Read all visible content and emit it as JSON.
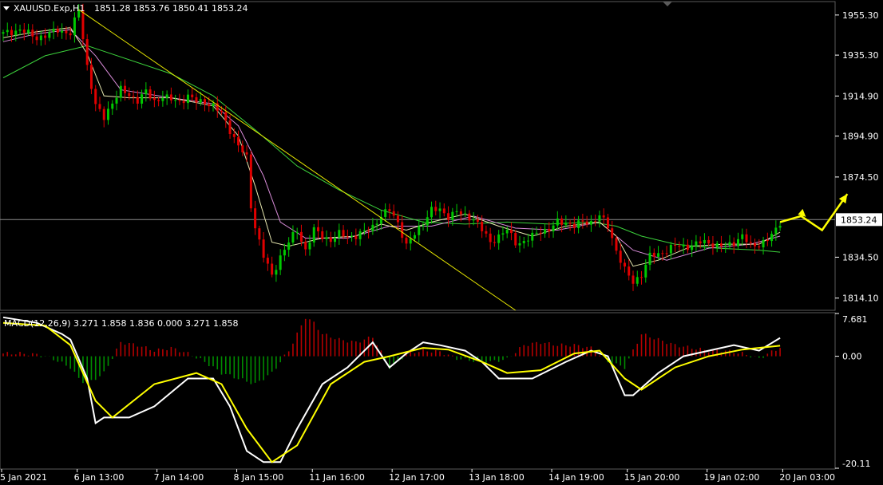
{
  "chart_data": [
    {
      "type": "candlestick",
      "title": "XAUUSD.Exp,H1",
      "ohlc_label": "1851.28 1853.76 1850.41 1853.24",
      "y_ticks": [
        "1955.30",
        "1935.30",
        "1914.90",
        "1894.90",
        "1874.50",
        "1834.50",
        "1814.10"
      ],
      "ylim": [
        1808,
        1962
      ],
      "current_price": 1853.24,
      "current_price_label": "1853.24",
      "x_labels": [
        "5 Jan 2021",
        "6 Jan 13:00",
        "7 Jan 14:00",
        "8 Jan 15:00",
        "11 Jan 16:00",
        "12 Jan 17:00",
        "13 Jan 18:00",
        "14 Jan 19:00",
        "15 Jan 20:00",
        "19 Jan 02:00",
        "20 Jan 03:00"
      ],
      "close_path": [
        [
          0,
          1946
        ],
        [
          4,
          1948
        ],
        [
          8,
          1944
        ],
        [
          10,
          1945
        ],
        [
          13,
          1948
        ],
        [
          16,
          1946
        ],
        [
          18,
          1958
        ],
        [
          20,
          1930
        ],
        [
          22,
          1910
        ],
        [
          24,
          1904
        ],
        [
          26,
          1912
        ],
        [
          28,
          1918
        ],
        [
          30,
          1915
        ],
        [
          32,
          1913
        ],
        [
          34,
          1917
        ],
        [
          36,
          1912
        ],
        [
          38,
          1915
        ],
        [
          40,
          1913
        ],
        [
          42,
          1912
        ],
        [
          44,
          1915
        ],
        [
          46,
          1912
        ],
        [
          48,
          1912
        ],
        [
          50,
          1910
        ],
        [
          52,
          1906
        ],
        [
          54,
          1898
        ],
        [
          56,
          1890
        ],
        [
          58,
          1884
        ],
        [
          59,
          1860
        ],
        [
          60,
          1850
        ],
        [
          62,
          1835
        ],
        [
          64,
          1825
        ],
        [
          66,
          1835
        ],
        [
          68,
          1842
        ],
        [
          70,
          1848
        ],
        [
          72,
          1838
        ],
        [
          74,
          1848
        ],
        [
          76,
          1845
        ],
        [
          78,
          1843
        ],
        [
          80,
          1846
        ],
        [
          82,
          1845
        ],
        [
          84,
          1845
        ],
        [
          86,
          1847
        ],
        [
          88,
          1850
        ],
        [
          90,
          1855
        ],
        [
          92,
          1858
        ],
        [
          94,
          1852
        ],
        [
          96,
          1840
        ],
        [
          98,
          1846
        ],
        [
          100,
          1852
        ],
        [
          102,
          1858
        ],
        [
          104,
          1858
        ],
        [
          106,
          1855
        ],
        [
          108,
          1857
        ],
        [
          110,
          1855
        ],
        [
          112,
          1854
        ],
        [
          114,
          1848
        ],
        [
          116,
          1842
        ],
        [
          118,
          1845
        ],
        [
          120,
          1848
        ],
        [
          122,
          1842
        ],
        [
          124,
          1842
        ],
        [
          126,
          1845
        ],
        [
          128,
          1848
        ],
        [
          130,
          1848
        ],
        [
          132,
          1852
        ],
        [
          134,
          1852
        ],
        [
          136,
          1850
        ],
        [
          138,
          1852
        ],
        [
          140,
          1852
        ],
        [
          142,
          1855
        ],
        [
          144,
          1850
        ],
        [
          146,
          1838
        ],
        [
          148,
          1828
        ],
        [
          150,
          1822
        ],
        [
          152,
          1826
        ],
        [
          154,
          1835
        ],
        [
          156,
          1836
        ],
        [
          158,
          1838
        ],
        [
          160,
          1840
        ],
        [
          162,
          1840
        ],
        [
          164,
          1840
        ],
        [
          166,
          1842
        ],
        [
          168,
          1842
        ],
        [
          170,
          1840
        ],
        [
          172,
          1840
        ],
        [
          174,
          1842
        ],
        [
          176,
          1845
        ],
        [
          178,
          1840
        ],
        [
          180,
          1841
        ],
        [
          182,
          1843
        ],
        [
          184,
          1848
        ],
        [
          185,
          1852
        ]
      ],
      "ma_fast": [
        [
          0,
          1944
        ],
        [
          8,
          1947
        ],
        [
          16,
          1949
        ],
        [
          20,
          1936
        ],
        [
          24,
          1915
        ],
        [
          30,
          1914
        ],
        [
          40,
          1914
        ],
        [
          50,
          1910
        ],
        [
          56,
          1895
        ],
        [
          60,
          1870
        ],
        [
          64,
          1842
        ],
        [
          68,
          1840
        ],
        [
          76,
          1844
        ],
        [
          84,
          1845
        ],
        [
          90,
          1851
        ],
        [
          96,
          1848
        ],
        [
          102,
          1852
        ],
        [
          110,
          1856
        ],
        [
          118,
          1850
        ],
        [
          126,
          1845
        ],
        [
          134,
          1850
        ],
        [
          142,
          1852
        ],
        [
          146,
          1845
        ],
        [
          150,
          1830
        ],
        [
          156,
          1833
        ],
        [
          164,
          1840
        ],
        [
          172,
          1841
        ],
        [
          180,
          1841
        ],
        [
          185,
          1847
        ]
      ],
      "ma_medium": [
        [
          0,
          1942
        ],
        [
          8,
          1946
        ],
        [
          16,
          1948
        ],
        [
          22,
          1935
        ],
        [
          28,
          1918
        ],
        [
          40,
          1914
        ],
        [
          50,
          1911
        ],
        [
          56,
          1900
        ],
        [
          62,
          1875
        ],
        [
          66,
          1852
        ],
        [
          72,
          1844
        ],
        [
          82,
          1844
        ],
        [
          92,
          1850
        ],
        [
          102,
          1850
        ],
        [
          112,
          1855
        ],
        [
          122,
          1849
        ],
        [
          132,
          1848
        ],
        [
          142,
          1852
        ],
        [
          150,
          1838
        ],
        [
          158,
          1833
        ],
        [
          168,
          1839
        ],
        [
          178,
          1841
        ],
        [
          185,
          1845
        ]
      ],
      "ma_slow": [
        [
          0,
          1924
        ],
        [
          10,
          1935
        ],
        [
          20,
          1940
        ],
        [
          40,
          1926
        ],
        [
          50,
          1915
        ],
        [
          60,
          1898
        ],
        [
          70,
          1880
        ],
        [
          80,
          1868
        ],
        [
          90,
          1858
        ],
        [
          100,
          1852
        ],
        [
          110,
          1851
        ],
        [
          120,
          1852
        ],
        [
          130,
          1851
        ],
        [
          140,
          1852
        ],
        [
          146,
          1850
        ],
        [
          152,
          1845
        ],
        [
          160,
          1841
        ],
        [
          170,
          1839
        ],
        [
          180,
          1838
        ],
        [
          185,
          1837
        ]
      ],
      "trendline": [
        [
          18,
          1958
        ],
        [
          122,
          1808
        ]
      ],
      "forecast_arrow": [
        [
          185,
          1852
        ],
        [
          190,
          1855
        ],
        [
          195,
          1848
        ],
        [
          201,
          1866
        ]
      ]
    },
    {
      "type": "macd",
      "title": "MACD(12,26,9) 3.271 1.858 1.836 0.000 3.271 1.858",
      "y_ticks": [
        "7.681",
        "0.00",
        "-20.11"
      ],
      "ylim": [
        -20.11,
        7.681
      ],
      "macd_line": [
        [
          0,
          7
        ],
        [
          8,
          6
        ],
        [
          14,
          4
        ],
        [
          16,
          3
        ],
        [
          20,
          -4
        ],
        [
          22,
          -12
        ],
        [
          24,
          -11
        ],
        [
          30,
          -11
        ],
        [
          36,
          -9
        ],
        [
          44,
          -4
        ],
        [
          50,
          -4
        ],
        [
          54,
          -9
        ],
        [
          58,
          -17
        ],
        [
          62,
          -19
        ],
        [
          66,
          -19
        ],
        [
          70,
          -13
        ],
        [
          76,
          -5
        ],
        [
          82,
          -2
        ],
        [
          86,
          1
        ],
        [
          88,
          2.5
        ],
        [
          92,
          -2
        ],
        [
          96,
          0.5
        ],
        [
          100,
          2.5
        ],
        [
          104,
          2
        ],
        [
          110,
          1
        ],
        [
          114,
          -1
        ],
        [
          118,
          -4
        ],
        [
          126,
          -4
        ],
        [
          134,
          -1
        ],
        [
          140,
          1
        ],
        [
          144,
          0
        ],
        [
          148,
          -7
        ],
        [
          150,
          -7
        ],
        [
          156,
          -3
        ],
        [
          162,
          0
        ],
        [
          168,
          1
        ],
        [
          174,
          2
        ],
        [
          180,
          1
        ],
        [
          185,
          3.3
        ]
      ],
      "signal_line": [
        [
          0,
          6
        ],
        [
          10,
          5.5
        ],
        [
          16,
          2
        ],
        [
          22,
          -8
        ],
        [
          26,
          -11
        ],
        [
          36,
          -5
        ],
        [
          46,
          -3
        ],
        [
          52,
          -5
        ],
        [
          58,
          -13
        ],
        [
          64,
          -19
        ],
        [
          70,
          -16
        ],
        [
          78,
          -5
        ],
        [
          86,
          -1
        ],
        [
          92,
          0
        ],
        [
          100,
          1.5
        ],
        [
          106,
          1.2
        ],
        [
          114,
          -1
        ],
        [
          120,
          -3
        ],
        [
          128,
          -2.5
        ],
        [
          136,
          0.5
        ],
        [
          142,
          1
        ],
        [
          148,
          -4
        ],
        [
          152,
          -6
        ],
        [
          160,
          -2
        ],
        [
          168,
          0
        ],
        [
          176,
          1.2
        ],
        [
          185,
          1.9
        ]
      ],
      "histogram": [
        [
          0,
          0.5
        ],
        [
          4,
          0.5
        ],
        [
          8,
          0.3
        ],
        [
          12,
          -0.5
        ],
        [
          16,
          -2
        ],
        [
          18,
          -4
        ],
        [
          20,
          -5
        ],
        [
          24,
          -3
        ],
        [
          28,
          2.5
        ],
        [
          32,
          2
        ],
        [
          36,
          1
        ],
        [
          40,
          1.5
        ],
        [
          44,
          0.5
        ],
        [
          48,
          -1
        ],
        [
          52,
          -3
        ],
        [
          56,
          -4
        ],
        [
          60,
          -5
        ],
        [
          64,
          -3
        ],
        [
          68,
          1
        ],
        [
          70,
          4
        ],
        [
          72,
          7
        ],
        [
          74,
          6
        ],
        [
          76,
          4
        ],
        [
          80,
          3
        ],
        [
          84,
          2.5
        ],
        [
          88,
          3.5
        ],
        [
          92,
          -2
        ],
        [
          94,
          -1
        ],
        [
          96,
          0.5
        ],
        [
          100,
          1
        ],
        [
          104,
          0.8
        ],
        [
          108,
          -0.4
        ],
        [
          112,
          -0.8
        ],
        [
          116,
          -1
        ],
        [
          120,
          -0.5
        ],
        [
          124,
          2
        ],
        [
          128,
          2.5
        ],
        [
          132,
          2
        ],
        [
          136,
          2
        ],
        [
          140,
          1.5
        ],
        [
          144,
          -1
        ],
        [
          148,
          -2
        ],
        [
          150,
          1
        ],
        [
          152,
          4
        ],
        [
          156,
          3
        ],
        [
          160,
          2
        ],
        [
          164,
          1.5
        ],
        [
          168,
          1
        ],
        [
          172,
          1
        ],
        [
          176,
          0.5
        ],
        [
          180,
          -0.4
        ],
        [
          185,
          1.6
        ]
      ]
    }
  ]
}
